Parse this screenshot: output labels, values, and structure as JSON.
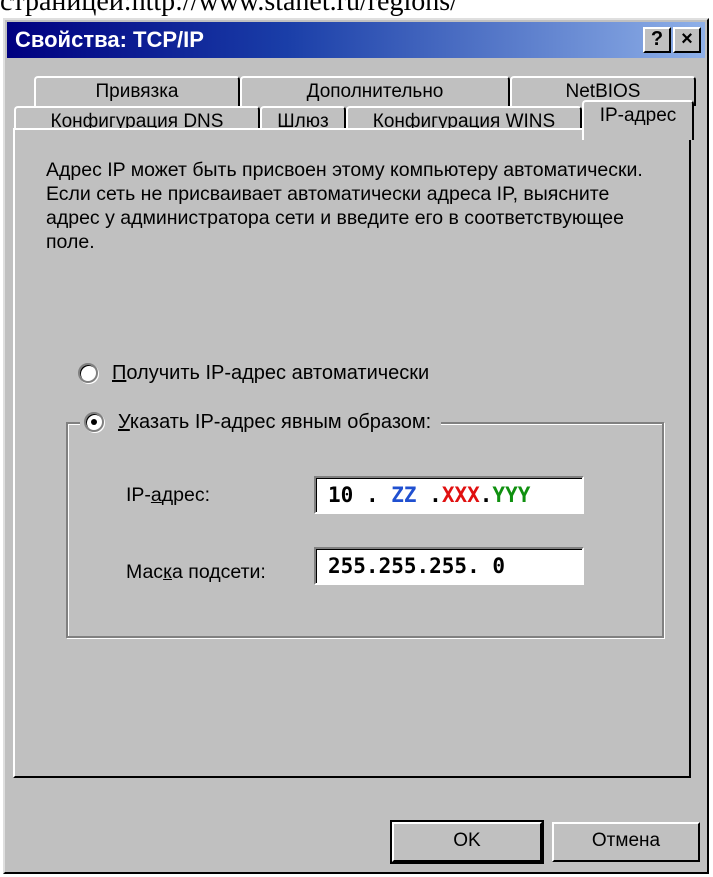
{
  "page_top_text": "страницей:http://www.stanet.ru/regions/",
  "window": {
    "title": "Свойства: TCP/IP",
    "help_label": "?",
    "close_label": "×"
  },
  "tabs_back": [
    {
      "label": "Привязка"
    },
    {
      "label": "Дополнительно"
    },
    {
      "label": "NetBIOS"
    }
  ],
  "tabs_front": [
    {
      "label": "Конфигурация DNS"
    },
    {
      "label": "Шлюз"
    },
    {
      "label": "Конфигурация WINS"
    },
    {
      "label": "IP-адрес",
      "active": true
    }
  ],
  "description": "Адрес IP может быть присвоен этому компьютеру автоматически. Если сеть не присваивает автоматически адреса IP, выясните адрес у администратора сети и введите его в соответствующее поле.",
  "options": {
    "auto": {
      "underline": "П",
      "rest": "олучить IP-адрес автоматически",
      "selected": false
    },
    "manual": {
      "underline": "У",
      "rest": "казать IP-адрес явным образом:",
      "selected": true
    }
  },
  "ip_address": {
    "label_pre": "IP-",
    "label_underline": "а",
    "label_post": "дрес:",
    "parts": [
      {
        "text": "10",
        "color": "#000000"
      },
      {
        "text": " . ",
        "color": "#000000"
      },
      {
        "text": "ZZ",
        "color": "#2050d0"
      },
      {
        "text": " .",
        "color": "#000000"
      },
      {
        "text": "XXX",
        "color": "#e01010"
      },
      {
        "text": ".",
        "color": "#000000"
      },
      {
        "text": "YYY",
        "color": "#109010"
      }
    ]
  },
  "subnet_mask": {
    "label_pre": "Мас",
    "label_underline": "к",
    "label_post": "а подсети:",
    "value": "255.255.255. 0"
  },
  "buttons": {
    "ok": "OK",
    "cancel": "Отмена"
  }
}
